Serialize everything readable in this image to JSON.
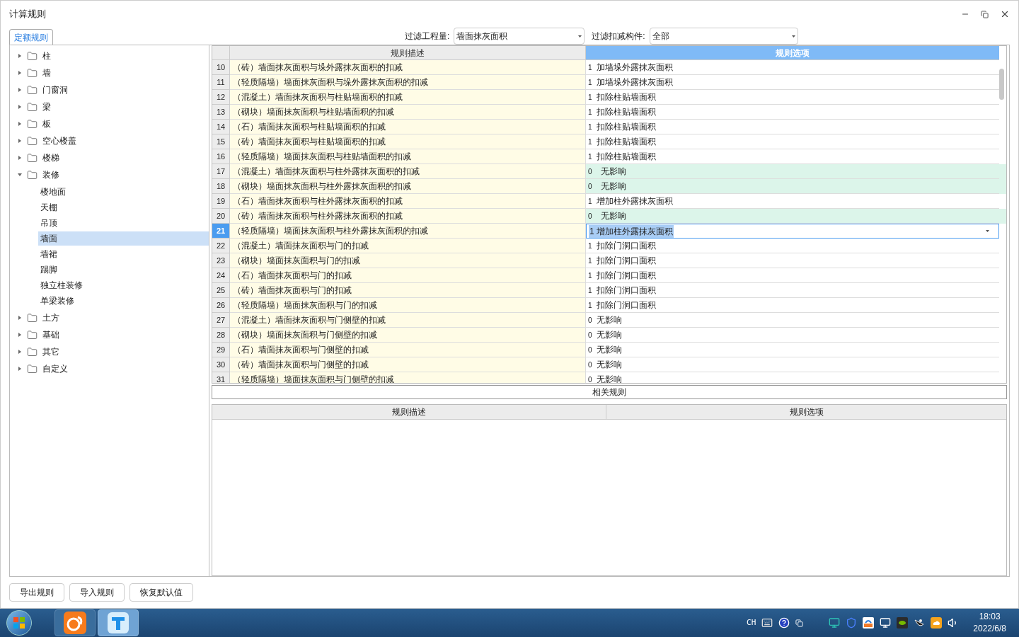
{
  "window": {
    "title": "计算规则"
  },
  "tabs": [
    {
      "label": "定额规则",
      "selected": true
    }
  ],
  "filters": [
    {
      "label": "过滤工程量:",
      "value": "墙面抹灰面积"
    },
    {
      "label": "过滤扣减构件:",
      "value": "全部"
    }
  ],
  "tree": [
    {
      "label": "柱",
      "expanded": false
    },
    {
      "label": "墙",
      "expanded": false
    },
    {
      "label": "门窗洞",
      "expanded": false
    },
    {
      "label": "梁",
      "expanded": false
    },
    {
      "label": "板",
      "expanded": false
    },
    {
      "label": "空心楼盖",
      "expanded": false
    },
    {
      "label": "楼梯",
      "expanded": false
    },
    {
      "label": "装修",
      "expanded": true,
      "children": [
        {
          "label": "楼地面",
          "selected": false
        },
        {
          "label": "天棚",
          "selected": false
        },
        {
          "label": "吊顶",
          "selected": false
        },
        {
          "label": "墙面",
          "selected": true
        },
        {
          "label": "墙裙",
          "selected": false
        },
        {
          "label": "踢脚",
          "selected": false
        },
        {
          "label": "独立柱装修",
          "selected": false
        },
        {
          "label": "单梁装修",
          "selected": false
        }
      ]
    },
    {
      "label": "土方",
      "expanded": false
    },
    {
      "label": "基础",
      "expanded": false
    },
    {
      "label": "其它",
      "expanded": false
    },
    {
      "label": "自定义",
      "expanded": false
    }
  ],
  "rules_table": {
    "columns": [
      "规则描述",
      "规则选项"
    ],
    "rows": [
      {
        "num": "10",
        "description": "（砖）墙面抹灰面积与垛外露抹灰面积的扣减",
        "code": "1",
        "option": "加墙垛外露抹灰面积",
        "changed": false,
        "selected": false
      },
      {
        "num": "11",
        "description": "（轻质隔墙）墙面抹灰面积与垛外露抹灰面积的扣减",
        "code": "1",
        "option": "加墙垛外露抹灰面积",
        "changed": false,
        "selected": false
      },
      {
        "num": "12",
        "description": "（混凝土）墙面抹灰面积与柱贴墙面积的扣减",
        "code": "1",
        "option": "扣除柱贴墙面积",
        "changed": false,
        "selected": false
      },
      {
        "num": "13",
        "description": "（砌块）墙面抹灰面积与柱贴墙面积的扣减",
        "code": "1",
        "option": "扣除柱贴墙面积",
        "changed": false,
        "selected": false
      },
      {
        "num": "14",
        "description": "（石）墙面抹灰面积与柱贴墙面积的扣减",
        "code": "1",
        "option": "扣除柱贴墙面积",
        "changed": false,
        "selected": false
      },
      {
        "num": "15",
        "description": "（砖）墙面抹灰面积与柱贴墙面积的扣减",
        "code": "1",
        "option": "扣除柱贴墙面积",
        "changed": false,
        "selected": false
      },
      {
        "num": "16",
        "description": "（轻质隔墙）墙面抹灰面积与柱贴墙面积的扣减",
        "code": "1",
        "option": "扣除柱贴墙面积",
        "changed": false,
        "selected": false
      },
      {
        "num": "17",
        "description": "（混凝土）墙面抹灰面积与柱外露抹灰面积的扣减",
        "code": "0",
        "option": "无影响",
        "changed": true,
        "selected": false
      },
      {
        "num": "18",
        "description": "（砌块）墙面抹灰面积与柱外露抹灰面积的扣减",
        "code": "0",
        "option": "无影响",
        "changed": true,
        "selected": false
      },
      {
        "num": "19",
        "description": "（石）墙面抹灰面积与柱外露抹灰面积的扣减",
        "code": "1",
        "option": "增加柱外露抹灰面积",
        "changed": false,
        "selected": false
      },
      {
        "num": "20",
        "description": "（砖）墙面抹灰面积与柱外露抹灰面积的扣减",
        "code": "0",
        "option": "无影响",
        "changed": true,
        "selected": false
      },
      {
        "num": "21",
        "description": "（轻质隔墙）墙面抹灰面积与柱外露抹灰面积的扣减",
        "code": "1",
        "option": "增加柱外露抹灰面积",
        "selected": true
      },
      {
        "num": "22",
        "description": "（混凝土）墙面抹灰面积与门的扣减",
        "code": "1",
        "option": "扣除门洞口面积",
        "changed": false,
        "selected": false
      },
      {
        "num": "23",
        "description": "（砌块）墙面抹灰面积与门的扣减",
        "code": "1",
        "option": "扣除门洞口面积",
        "changed": false,
        "selected": false
      },
      {
        "num": "24",
        "description": "（石）墙面抹灰面积与门的扣减",
        "code": "1",
        "option": "扣除门洞口面积",
        "changed": false,
        "selected": false
      },
      {
        "num": "25",
        "description": "（砖）墙面抹灰面积与门的扣减",
        "code": "1",
        "option": "扣除门洞口面积",
        "changed": false,
        "selected": false
      },
      {
        "num": "26",
        "description": "（轻质隔墙）墙面抹灰面积与门的扣减",
        "code": "1",
        "option": "扣除门洞口面积",
        "changed": false,
        "selected": false
      },
      {
        "num": "27",
        "description": "（混凝土）墙面抹灰面积与门侧壁的扣减",
        "code": "0",
        "option": "无影响",
        "changed": false,
        "selected": false
      },
      {
        "num": "28",
        "description": "（砌块）墙面抹灰面积与门侧壁的扣减",
        "code": "0",
        "option": "无影响",
        "changed": false,
        "selected": false
      },
      {
        "num": "29",
        "description": "（石）墙面抹灰面积与门侧壁的扣减",
        "code": "0",
        "option": "无影响",
        "changed": false,
        "selected": false
      },
      {
        "num": "30",
        "description": "（砖）墙面抹灰面积与门侧壁的扣减",
        "code": "0",
        "option": "无影响",
        "changed": false,
        "selected": false
      },
      {
        "num": "31",
        "description": "（轻质隔墙）墙面抹灰面积与门侧壁的扣减",
        "code": "0",
        "option": "无影响",
        "changed": false,
        "selected": false
      }
    ]
  },
  "related": {
    "title": "相关规则",
    "columns": [
      "规则描述",
      "规则选项"
    ]
  },
  "buttons": [
    "导出规则",
    "导入规则",
    "恢复默认值"
  ],
  "taskbar": {
    "input_lang": "CH",
    "time": "18:03",
    "date": "2022/6/8"
  }
}
